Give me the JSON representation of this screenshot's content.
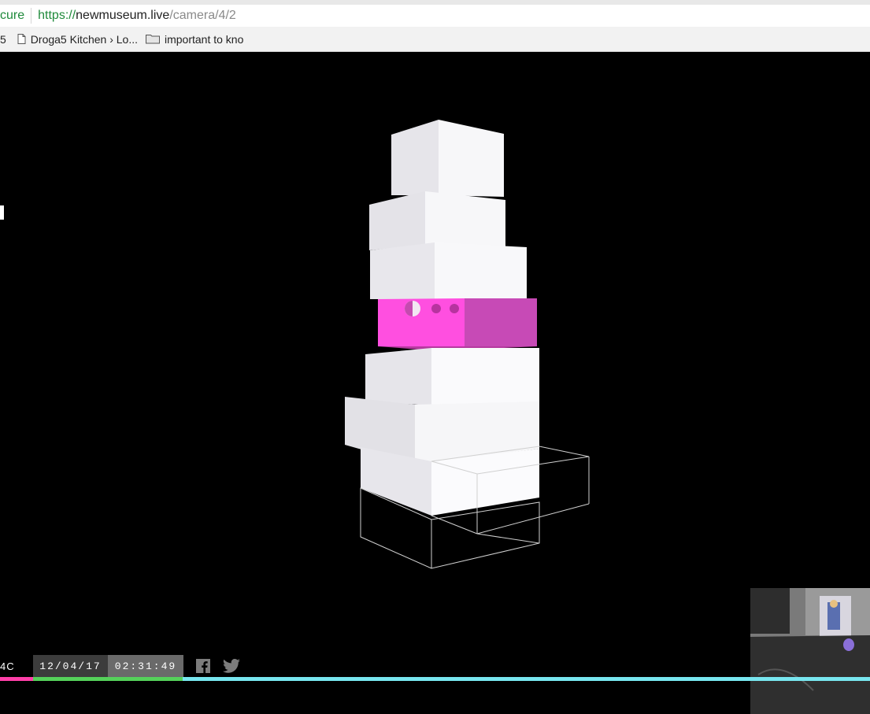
{
  "browser": {
    "secure_label": "cure",
    "url_protocol": "https://",
    "url_host": "newmuseum.live",
    "url_path": "/camera/4/2"
  },
  "bookmarks": {
    "cut_item": "5",
    "items": [
      {
        "label": "Droga5 Kitchen › Lo...",
        "icon": "page-icon"
      },
      {
        "label": "important to kno",
        "icon": "folder-icon"
      }
    ]
  },
  "footer": {
    "temperature": "4C",
    "date": "12/04/17",
    "time": "02:31:49",
    "social": [
      "facebook-icon",
      "twitter-icon"
    ]
  },
  "colors": {
    "accent_magenta": "#ff4fe0",
    "bar_colors": [
      "#ff3fa8",
      "#55d15a",
      "#78e6ef",
      "#a8a8a8"
    ]
  }
}
